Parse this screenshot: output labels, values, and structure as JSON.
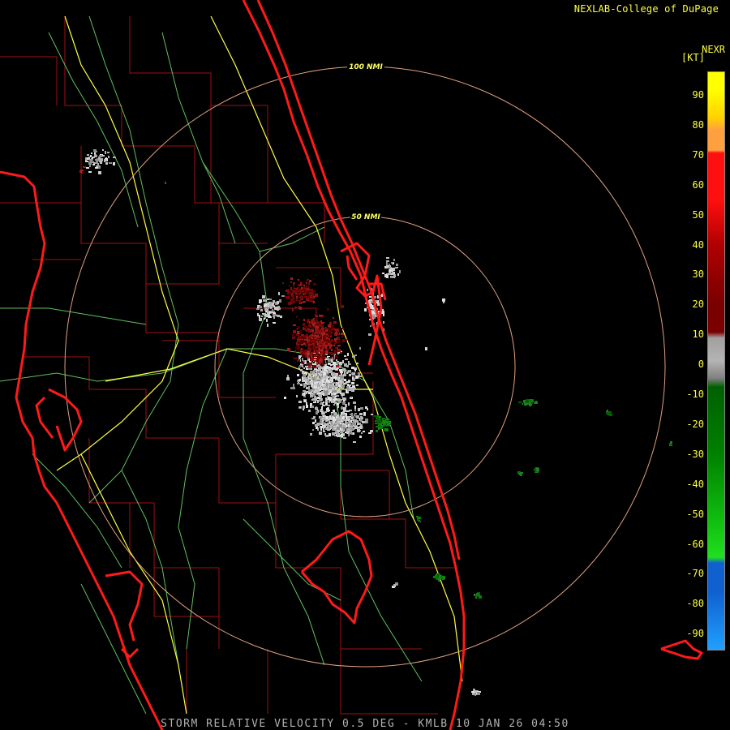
{
  "header": {
    "credit": "NEXLAB-College of DuPage",
    "product": "NEXR",
    "unit": "[KT]"
  },
  "rings": [
    {
      "label": "100 NMI"
    },
    {
      "label": "50 NMI"
    }
  ],
  "legend": {
    "ticks": [
      "90",
      "80",
      "70",
      "60",
      "50",
      "40",
      "30",
      "20",
      "10",
      "0",
      "-10",
      "-20",
      "-30",
      "-40",
      "-50",
      "-60",
      "-70",
      "-80",
      "-90"
    ],
    "colors": {
      "yellow": "#ffff00",
      "orange": "#ffa040",
      "red": "#ff1010",
      "darkred": "#7a0000",
      "gray": "#b4b4b4",
      "darkgreen": "#006000",
      "green": "#20e020",
      "blue": "#1060d0",
      "lightblue": "#20a0ff"
    }
  },
  "map_colors": {
    "coast": "#ff1a1a",
    "county": "#a01010",
    "road": "#60c060",
    "interstate": "#ffff40",
    "ring": "#e0a080"
  },
  "footer": {
    "caption": "STORM RELATIVE VELOCITY 0.5 DEG - KMLB 10 JAN 26 04:50"
  }
}
